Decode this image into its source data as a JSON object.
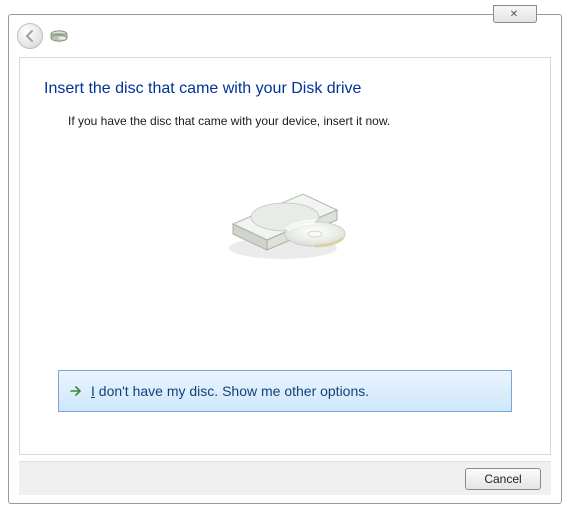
{
  "window": {
    "close_glyph": "✕"
  },
  "header": {
    "title": "Insert the disc that came with your Disk drive",
    "subtitle": "If you have the disc that came with your device, insert it now."
  },
  "option": {
    "label_prefix": "I",
    "label_rest": " don't have my disc.  Show me other options."
  },
  "footer": {
    "cancel_label": "Cancel"
  },
  "icons": {
    "back": "back-arrow-icon",
    "device": "disk-drive-icon",
    "option_arrow": "command-arrow-icon",
    "drive_image": "optical-drive-image"
  }
}
